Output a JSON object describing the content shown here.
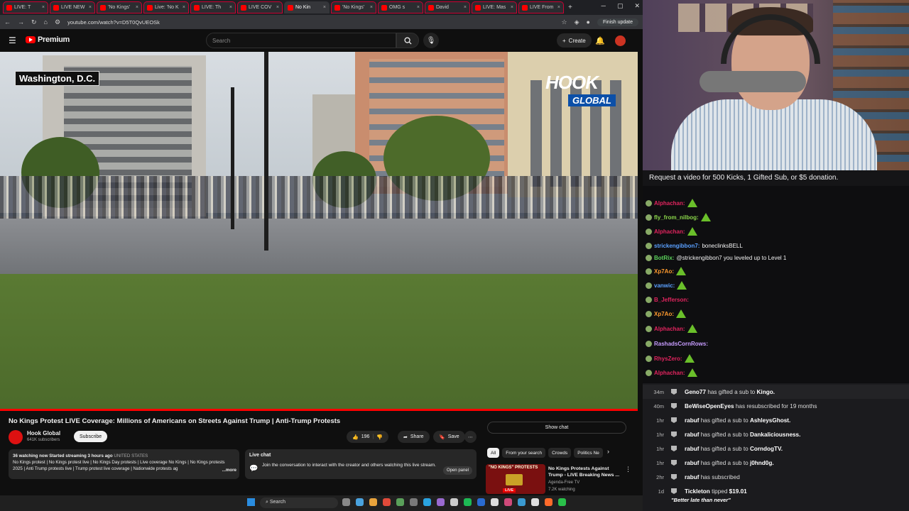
{
  "browser": {
    "tabs": [
      {
        "label": "LIVE: T"
      },
      {
        "label": "LIVE NEW"
      },
      {
        "label": "'No Kings'"
      },
      {
        "label": "Live: 'No K"
      },
      {
        "label": "LIVE: Th"
      },
      {
        "label": "LIVE COV"
      },
      {
        "label": "No Kin",
        "active": true
      },
      {
        "label": "'No Kings'"
      },
      {
        "label": "OMG s"
      },
      {
        "label": "David"
      },
      {
        "label": "LIVE: Mas"
      },
      {
        "label": "LIVE From"
      }
    ],
    "url": "youtube.com/watch?v=D5T0QvUEOSk",
    "finish_update": "Finish update"
  },
  "youtube": {
    "logo": "Premium",
    "search_placeholder": "Search",
    "create_label": "Create",
    "video": {
      "location_label": "Washington, D.C.",
      "watermark_top": "HOOK",
      "watermark_bottom": "GLOBAL"
    },
    "title": "No Kings Protest LIVE Coverage: Millions of Americans on Streets Against Trump | Anti-Trump Protests",
    "channel": {
      "name": "Hook Global",
      "subscribers": "641K subscribers",
      "subscribe_label": "Subscribe"
    },
    "likes": "196",
    "share_label": "Share",
    "save_label": "Save",
    "description": {
      "stats": "36 watching now  Started streaming 3 hours ago",
      "country": "UNITED STATES",
      "tags": "No Kings protest | No Kings protest live | No Kings Day protests | Live coverage No Kings | No Kings protests 2025 | Anti Trump protests live | Trump protest live coverage | Nationwide protests ag",
      "more": "...more"
    },
    "live_chat": {
      "title": "Live chat",
      "text": "Join the conversation to interact with the creator and others watching this live stream.",
      "open_panel": "Open panel"
    },
    "show_chat": "Show chat",
    "chips": [
      "All",
      "From your search",
      "Crowds",
      "Politics Ne"
    ],
    "recommended": {
      "thumb_text": "\"NO KINGS\" PROTESTS",
      "thumb_badge": "LIVE",
      "title": "No Kings Protests Against Trump - LIVE Breaking News ...",
      "channel": "Agenda-Free TV",
      "watching": "7.2K watching"
    }
  },
  "taskbar": {
    "search_label": "Search"
  },
  "stream_chat": {
    "banner": "Request a video for 500 Kicks, 1 Gifted Sub, or $5 donation.",
    "messages": [
      {
        "user": "Alphachan:",
        "text": "",
        "color": "#e0245e",
        "emote": true
      },
      {
        "user": "fly_from_nilbog:",
        "text": "",
        "color": "#8bd84a",
        "emote": true
      },
      {
        "user": "Alphachan:",
        "text": "",
        "color": "#e0245e",
        "emote": true
      },
      {
        "user": "strickengibbon7:",
        "text": "boneclinksBELL",
        "color": "#5aa0ff",
        "emote": false
      },
      {
        "user": "BotRix:",
        "text": "@strickengibbon7 you leveled up to Level 1",
        "color": "#5bd35b",
        "emote": false
      },
      {
        "user": "Xp7Ao:",
        "text": "",
        "color": "#ff9a2e",
        "emote": true
      },
      {
        "user": "vanwic:",
        "text": "",
        "color": "#5aa0ff",
        "emote": true
      },
      {
        "user": "B_Jefferson:",
        "text": "",
        "color": "#e0245e",
        "emote": false
      },
      {
        "user": "Xp7Ao:",
        "text": "",
        "color": "#ff9a2e",
        "emote": true
      },
      {
        "user": "Alphachan:",
        "text": "",
        "color": "#e0245e",
        "emote": true
      },
      {
        "user": "RashadsCornRows:",
        "text": "",
        "color": "#c79cff",
        "emote": false
      },
      {
        "user": "RhysZero:",
        "text": "",
        "color": "#e0245e",
        "emote": true
      },
      {
        "user": "Alphachan:",
        "text": "",
        "color": "#e0245e",
        "emote": true
      }
    ]
  },
  "events": [
    {
      "time": "34m",
      "user": "Geno77",
      "text": " has gifted a sub to ",
      "target": "Kingo."
    },
    {
      "time": "40m",
      "user": "BeWiseOpenEyes",
      "text": " has resubscribed for 19 months",
      "target": ""
    },
    {
      "time": "1hr",
      "user": "rabuf",
      "text": " has gifted a sub to ",
      "target": "AshleysGhost."
    },
    {
      "time": "1hr",
      "user": "rabuf",
      "text": " has gifted a sub to ",
      "target": "Dankaliciousness."
    },
    {
      "time": "1hr",
      "user": "rabuf",
      "text": " has gifted a sub to ",
      "target": "CorndogTV."
    },
    {
      "time": "1hr",
      "user": "rabuf",
      "text": " has gifted a sub to ",
      "target": "j0hnd0g."
    },
    {
      "time": "2hr",
      "user": "rabuf",
      "text": " has subscribed",
      "target": ""
    },
    {
      "time": "1d",
      "user": "Tickleton",
      "text": " tipped ",
      "target": "$19.01"
    }
  ],
  "tip_message": "\"Better late than never\""
}
